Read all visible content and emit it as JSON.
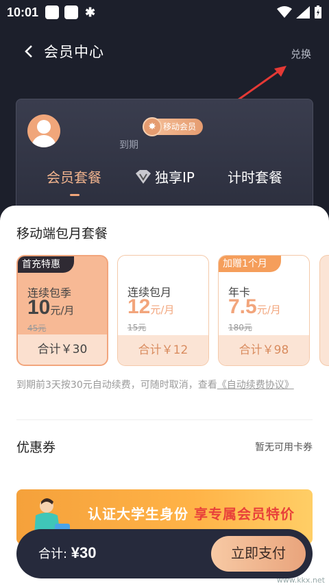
{
  "status_bar": {
    "time": "10:01"
  },
  "nav": {
    "title": "会员中心",
    "action": "兑换"
  },
  "member": {
    "badge": "移动会员",
    "expire_text": "到期"
  },
  "tabs": [
    {
      "label": "会员套餐"
    },
    {
      "label": "独享IP"
    },
    {
      "label": "计时套餐"
    }
  ],
  "panel": {
    "title": "移动端包月套餐",
    "plans": [
      {
        "tag": "首充特惠",
        "name": "连续包季",
        "price": "10",
        "unit": "元/月",
        "old": "45元",
        "total": "合计￥30"
      },
      {
        "tag": "",
        "name": "连续包月",
        "price": "12",
        "unit": "元/月",
        "old": "15元",
        "total": "合计￥12"
      },
      {
        "tag": "加赠1个月",
        "name": "年卡",
        "price": "7.5",
        "unit": "元/月",
        "old": "180元",
        "total": "合计￥98"
      }
    ],
    "renew_note": "到期前3天按30元自动续费，可随时取消，查看",
    "renew_link": "《自动续费协议》",
    "coupon_label": "优惠券",
    "coupon_value": "暂无可用卡券",
    "banner_text_1": "认证大学生身份",
    "banner_text_2": "享专属会员特价"
  },
  "pay": {
    "total_label": "合计: ",
    "total_amount": "¥30",
    "button": "立即支付"
  },
  "watermark": "www.kkx.net"
}
